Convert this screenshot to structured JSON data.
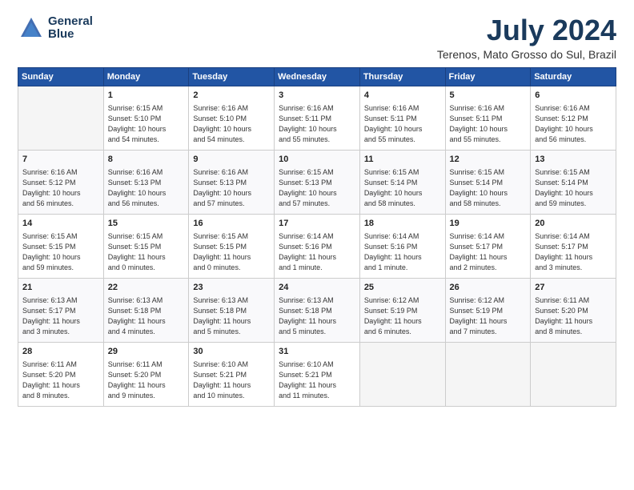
{
  "logo": {
    "line1": "General",
    "line2": "Blue"
  },
  "title": "July 2024",
  "location": "Terenos, Mato Grosso do Sul, Brazil",
  "weekdays": [
    "Sunday",
    "Monday",
    "Tuesday",
    "Wednesday",
    "Thursday",
    "Friday",
    "Saturday"
  ],
  "weeks": [
    [
      {
        "day": "",
        "info": ""
      },
      {
        "day": "1",
        "info": "Sunrise: 6:15 AM\nSunset: 5:10 PM\nDaylight: 10 hours\nand 54 minutes."
      },
      {
        "day": "2",
        "info": "Sunrise: 6:16 AM\nSunset: 5:10 PM\nDaylight: 10 hours\nand 54 minutes."
      },
      {
        "day": "3",
        "info": "Sunrise: 6:16 AM\nSunset: 5:11 PM\nDaylight: 10 hours\nand 55 minutes."
      },
      {
        "day": "4",
        "info": "Sunrise: 6:16 AM\nSunset: 5:11 PM\nDaylight: 10 hours\nand 55 minutes."
      },
      {
        "day": "5",
        "info": "Sunrise: 6:16 AM\nSunset: 5:11 PM\nDaylight: 10 hours\nand 55 minutes."
      },
      {
        "day": "6",
        "info": "Sunrise: 6:16 AM\nSunset: 5:12 PM\nDaylight: 10 hours\nand 56 minutes."
      }
    ],
    [
      {
        "day": "7",
        "info": "Sunrise: 6:16 AM\nSunset: 5:12 PM\nDaylight: 10 hours\nand 56 minutes."
      },
      {
        "day": "8",
        "info": "Sunrise: 6:16 AM\nSunset: 5:13 PM\nDaylight: 10 hours\nand 56 minutes."
      },
      {
        "day": "9",
        "info": "Sunrise: 6:16 AM\nSunset: 5:13 PM\nDaylight: 10 hours\nand 57 minutes."
      },
      {
        "day": "10",
        "info": "Sunrise: 6:15 AM\nSunset: 5:13 PM\nDaylight: 10 hours\nand 57 minutes."
      },
      {
        "day": "11",
        "info": "Sunrise: 6:15 AM\nSunset: 5:14 PM\nDaylight: 10 hours\nand 58 minutes."
      },
      {
        "day": "12",
        "info": "Sunrise: 6:15 AM\nSunset: 5:14 PM\nDaylight: 10 hours\nand 58 minutes."
      },
      {
        "day": "13",
        "info": "Sunrise: 6:15 AM\nSunset: 5:14 PM\nDaylight: 10 hours\nand 59 minutes."
      }
    ],
    [
      {
        "day": "14",
        "info": "Sunrise: 6:15 AM\nSunset: 5:15 PM\nDaylight: 10 hours\nand 59 minutes."
      },
      {
        "day": "15",
        "info": "Sunrise: 6:15 AM\nSunset: 5:15 PM\nDaylight: 11 hours\nand 0 minutes."
      },
      {
        "day": "16",
        "info": "Sunrise: 6:15 AM\nSunset: 5:15 PM\nDaylight: 11 hours\nand 0 minutes."
      },
      {
        "day": "17",
        "info": "Sunrise: 6:14 AM\nSunset: 5:16 PM\nDaylight: 11 hours\nand 1 minute."
      },
      {
        "day": "18",
        "info": "Sunrise: 6:14 AM\nSunset: 5:16 PM\nDaylight: 11 hours\nand 1 minute."
      },
      {
        "day": "19",
        "info": "Sunrise: 6:14 AM\nSunset: 5:17 PM\nDaylight: 11 hours\nand 2 minutes."
      },
      {
        "day": "20",
        "info": "Sunrise: 6:14 AM\nSunset: 5:17 PM\nDaylight: 11 hours\nand 3 minutes."
      }
    ],
    [
      {
        "day": "21",
        "info": "Sunrise: 6:13 AM\nSunset: 5:17 PM\nDaylight: 11 hours\nand 3 minutes."
      },
      {
        "day": "22",
        "info": "Sunrise: 6:13 AM\nSunset: 5:18 PM\nDaylight: 11 hours\nand 4 minutes."
      },
      {
        "day": "23",
        "info": "Sunrise: 6:13 AM\nSunset: 5:18 PM\nDaylight: 11 hours\nand 5 minutes."
      },
      {
        "day": "24",
        "info": "Sunrise: 6:13 AM\nSunset: 5:18 PM\nDaylight: 11 hours\nand 5 minutes."
      },
      {
        "day": "25",
        "info": "Sunrise: 6:12 AM\nSunset: 5:19 PM\nDaylight: 11 hours\nand 6 minutes."
      },
      {
        "day": "26",
        "info": "Sunrise: 6:12 AM\nSunset: 5:19 PM\nDaylight: 11 hours\nand 7 minutes."
      },
      {
        "day": "27",
        "info": "Sunrise: 6:11 AM\nSunset: 5:20 PM\nDaylight: 11 hours\nand 8 minutes."
      }
    ],
    [
      {
        "day": "28",
        "info": "Sunrise: 6:11 AM\nSunset: 5:20 PM\nDaylight: 11 hours\nand 8 minutes."
      },
      {
        "day": "29",
        "info": "Sunrise: 6:11 AM\nSunset: 5:20 PM\nDaylight: 11 hours\nand 9 minutes."
      },
      {
        "day": "30",
        "info": "Sunrise: 6:10 AM\nSunset: 5:21 PM\nDaylight: 11 hours\nand 10 minutes."
      },
      {
        "day": "31",
        "info": "Sunrise: 6:10 AM\nSunset: 5:21 PM\nDaylight: 11 hours\nand 11 minutes."
      },
      {
        "day": "",
        "info": ""
      },
      {
        "day": "",
        "info": ""
      },
      {
        "day": "",
        "info": ""
      }
    ]
  ]
}
